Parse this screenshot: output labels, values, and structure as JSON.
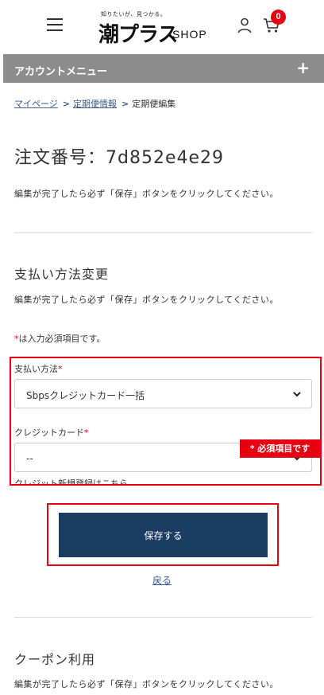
{
  "header": {
    "logo_tagline": "知りたいが、見つかる。",
    "logo_main": "潮プラス",
    "logo_shop": "SHOP",
    "cart_count": "0"
  },
  "account_menu": {
    "label": "アカウントメニュー",
    "toggle": "+"
  },
  "breadcrumb": {
    "items": [
      "マイページ",
      "定期便情報"
    ],
    "current": "定期便編集",
    "separator": ">"
  },
  "page": {
    "title": "注文番号：7d852e4e29",
    "note": "編集が完了したら必ず「保存」ボタンをクリックしてください。"
  },
  "payment_section": {
    "title": "支払い方法変更",
    "note": "編集が完了したら必ず「保存」ボタンをクリックしてください。",
    "required_note_mark": "*",
    "required_note_text": "は入力必須項目です。",
    "payment_method_label": "支払い方法",
    "payment_method_value": "Sbpsクレジットカード一括",
    "credit_card_label": "クレジットカード",
    "credit_card_value": "--",
    "required_mark": "*",
    "required_tag": "* 必須項目です",
    "new_card_link": "クレジット新規登録はこちら",
    "save_button": "保存する",
    "back_link": "戻る"
  },
  "coupon_section": {
    "title": "クーポン利用",
    "note": "編集が完了したら必ず「保存」ボタンをクリックしてください。"
  },
  "colors": {
    "accent_red": "#e60012",
    "button_navy": "#1b3c63",
    "menu_gray": "#8c8c8c",
    "link_blue": "#3a5d8a"
  }
}
